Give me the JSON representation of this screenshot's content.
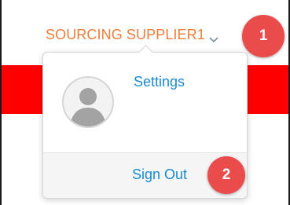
{
  "header": {
    "user_name": "SOURCING SUPPLIER1"
  },
  "user_menu": {
    "settings_label": "Settings",
    "sign_out_label": "Sign Out"
  },
  "annotations": {
    "step_1": "1",
    "step_2": "2"
  },
  "icons": {
    "menu_toggle": "chevron-down-icon",
    "avatar": "default-user-avatar-icon"
  },
  "colors": {
    "username_orange": "#ee7d3b",
    "link_blue": "#1a8ad0",
    "banner_red": "#ff0000",
    "badge_red": "#ea4b4b",
    "chevron_gray": "#7a8fa3"
  }
}
